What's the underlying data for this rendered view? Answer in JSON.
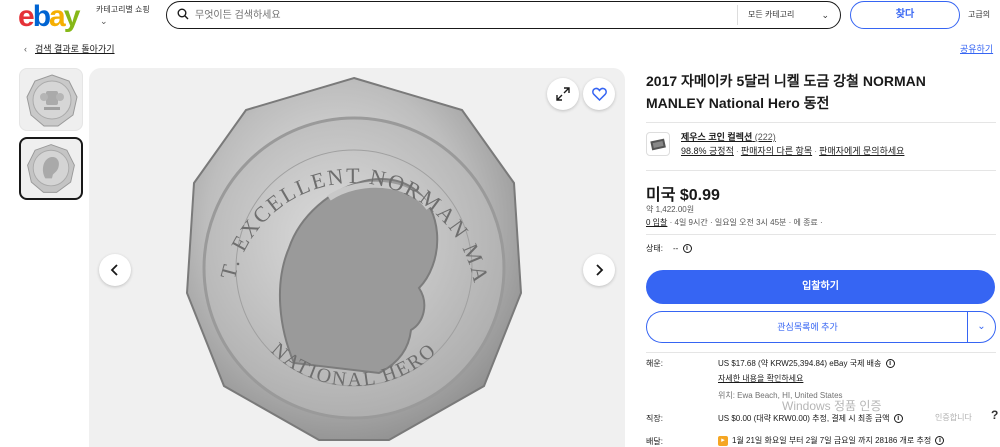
{
  "header": {
    "logo_e": "e",
    "logo_b": "b",
    "logo_a": "a",
    "logo_y": "y",
    "categories_label": "카테고리별 쇼핑",
    "search_placeholder": "무엇이든 검색하세요",
    "category_select": "모든 카테고리",
    "search_button": "찾다",
    "advanced_link": "고급의"
  },
  "nav": {
    "back_label": "검색 결과로 돌아가기",
    "share_label": "공유하기"
  },
  "listing": {
    "title": "2017 자메이카 5달러 니켈 도금 강철 NORMAN MANLEY National Hero 동전",
    "seller": {
      "name": "제우스 코인 컬렉션",
      "feedback_count": "(222)",
      "positive": "98.8% 긍정적",
      "other_items": "판매자의 다른 항목",
      "contact": "판매자에게 문의하세요"
    },
    "price": "미국 $0.99",
    "approx_price": "약 1,422.00원",
    "bids": "0 입찰",
    "time_left": "· 4일 9시간 · 일요일 오전 3시 45분 · 에 종료 ·",
    "condition_label": "상태:",
    "condition_value": "--",
    "bid_button": "입찰하기",
    "watch_button": "관심목록에 추가"
  },
  "shipping": {
    "shipping_label": "해운:",
    "shipping_value": "US $17.68 (약 KRW25,394.84) eBay 국제 배송",
    "details_link": "자세한 내용을 확인하세요",
    "location": "위치: Ewa Beach, HI, United States",
    "import_label": "직장:",
    "import_value": "US $0.00 (대략 KRW0.00) 추정, 결제 시 최종 금액",
    "delivery_label": "배달:",
    "delivery_value": "1월 21일 화요일 부터 2월 7일 금요일 까지 28186 개로 추정"
  },
  "overlay": {
    "windows_watermark": "Windows 정품 인증",
    "windows_sub": "인증합니다",
    "help": "?"
  },
  "icons": {
    "search": "search-icon",
    "expand": "expand-icon",
    "heart": "heart-icon",
    "prev": "chevron-left-icon",
    "next": "chevron-right-icon",
    "info": "info-icon"
  },
  "colors": {
    "accent": "#3665f3",
    "logo_red": "#e53238",
    "logo_blue": "#0064d2",
    "logo_yellow": "#f5af02",
    "logo_green": "#86b817"
  }
}
